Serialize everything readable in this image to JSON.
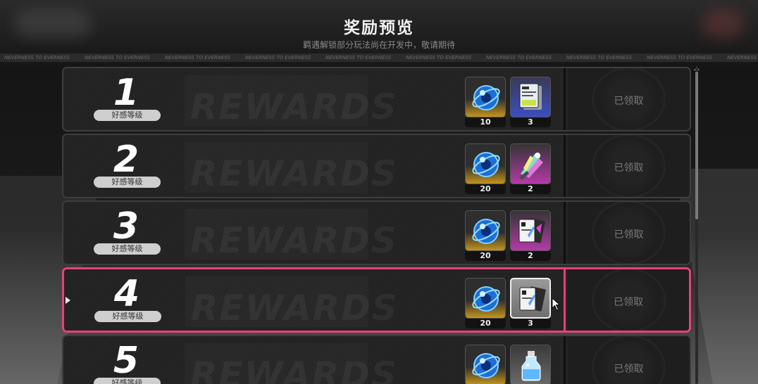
{
  "header": {
    "title": "奖励预览",
    "subtitle": "羁遇解锁部分玩法尚在开发中，敬请期待"
  },
  "ticker": {
    "text": "NEVERNESS TO EVERNESS"
  },
  "rows": [
    {
      "level": "1",
      "level_label": "好感等级",
      "status": "已领取",
      "selected": false,
      "rewards": [
        {
          "icon": "blue-orb-icon",
          "rarity": "gold",
          "qty": "10"
        },
        {
          "icon": "id-card-icon",
          "rarity": "blue",
          "qty": "3"
        }
      ]
    },
    {
      "level": "2",
      "level_label": "好感等级",
      "status": "已领取",
      "selected": false,
      "rewards": [
        {
          "icon": "blue-orb-icon",
          "rarity": "gold",
          "qty": "20"
        },
        {
          "icon": "crystal-bouquet-icon",
          "rarity": "purple",
          "qty": "2"
        }
      ]
    },
    {
      "level": "3",
      "level_label": "好感等级",
      "status": "已领取",
      "selected": false,
      "rewards": [
        {
          "icon": "blue-orb-icon",
          "rarity": "gold",
          "qty": "20"
        },
        {
          "icon": "card-pack-icon",
          "rarity": "purple",
          "qty": "2"
        }
      ]
    },
    {
      "level": "4",
      "level_label": "好感等级",
      "status": "已领取",
      "selected": true,
      "rewards": [
        {
          "icon": "blue-orb-icon",
          "rarity": "gold",
          "qty": "20"
        },
        {
          "icon": "card-pack-icon",
          "rarity": "gray",
          "qty": "3"
        }
      ]
    },
    {
      "level": "5",
      "level_label": "好感等级",
      "status": "已领取",
      "selected": false,
      "rewards": [
        {
          "icon": "blue-orb-icon",
          "rarity": "gold",
          "qty": ""
        },
        {
          "icon": "potion-bottle-icon",
          "rarity": "gray",
          "qty": ""
        }
      ]
    }
  ],
  "watermark": "REWARDS",
  "colors": {
    "selected_border": "#e9407a",
    "gold_rarity": "#c3941e",
    "blue_rarity": "#3b4fbf",
    "purple_rarity": "#b43aa8"
  }
}
